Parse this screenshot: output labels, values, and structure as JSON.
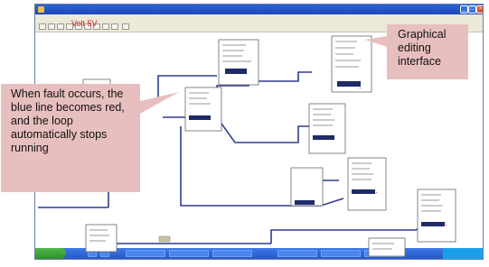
{
  "window": {
    "title": "",
    "voltage_label": "Volt 5V"
  },
  "menu": {
    "items": [
      "",
      "",
      "",
      "",
      "",
      ""
    ]
  },
  "callouts": {
    "fault": "When fault occurs, the blue line becomes red, and the loop automatically stops running",
    "editor": "Graphical editing interface"
  },
  "colors": {
    "line": "#2f3d8f",
    "callout_bg": "#e8bfbf",
    "volt_label": "#d22020"
  }
}
